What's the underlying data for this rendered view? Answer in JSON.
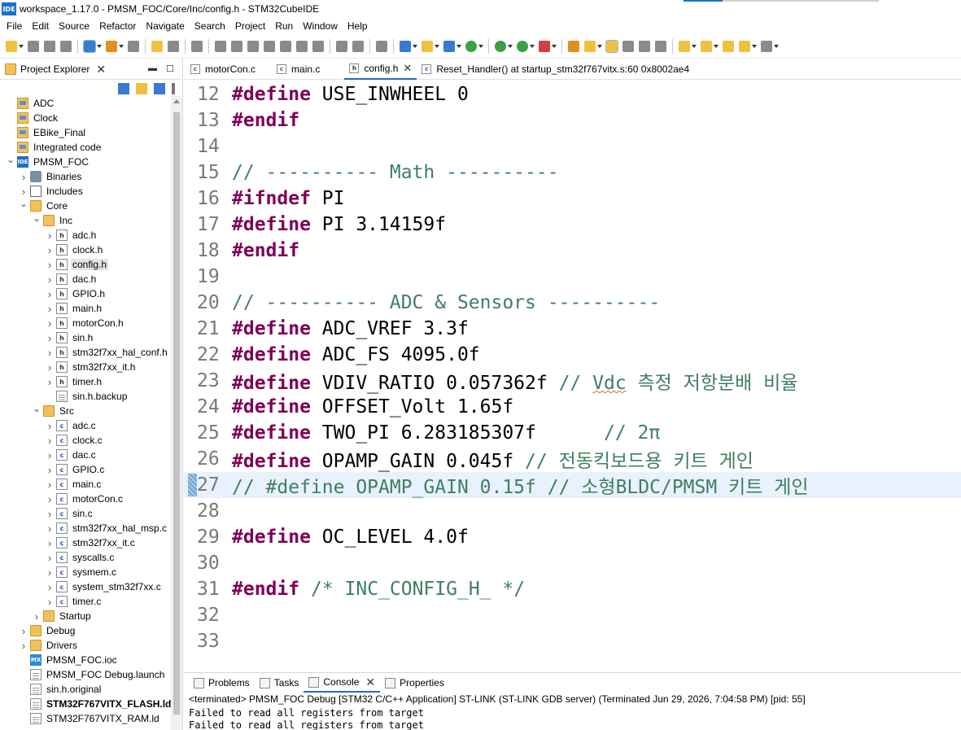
{
  "window": {
    "title": "workspace_1.17.0 - PMSM_FOC/Core/Inc/config.h - STM32CubeIDE",
    "app_icon": "IDE"
  },
  "menu": [
    "File",
    "Edit",
    "Source",
    "Refactor",
    "Navigate",
    "Search",
    "Project",
    "Run",
    "Window",
    "Help"
  ],
  "project_explorer": {
    "title": "Project Explorer",
    "tree": [
      {
        "label": "ADC",
        "icon": "project-folder-icon",
        "depth": 0,
        "arrow": ""
      },
      {
        "label": "Clock",
        "icon": "project-folder-icon",
        "depth": 0,
        "arrow": ""
      },
      {
        "label": "EBike_Final",
        "icon": "project-folder-icon",
        "depth": 0,
        "arrow": ""
      },
      {
        "label": "Integrated code",
        "icon": "project-folder-icon",
        "depth": 0,
        "arrow": ""
      },
      {
        "label": "PMSM_FOC",
        "icon": "ide-project-icon",
        "depth": 0,
        "arrow": "down"
      },
      {
        "label": "Binaries",
        "icon": "binaries-icon",
        "depth": 1,
        "arrow": "right"
      },
      {
        "label": "Includes",
        "icon": "includes-icon",
        "depth": 1,
        "arrow": "right"
      },
      {
        "label": "Core",
        "icon": "folder-icon",
        "depth": 1,
        "arrow": "down"
      },
      {
        "label": "Inc",
        "icon": "folder-icon",
        "depth": 2,
        "arrow": "down"
      },
      {
        "label": "adc.h",
        "icon": "header-file-icon",
        "depth": 3,
        "arrow": "right"
      },
      {
        "label": "clock.h",
        "icon": "header-file-icon",
        "depth": 3,
        "arrow": "right"
      },
      {
        "label": "config.h",
        "icon": "header-file-icon",
        "depth": 3,
        "arrow": "right",
        "selected": true
      },
      {
        "label": "dac.h",
        "icon": "header-file-icon",
        "depth": 3,
        "arrow": "right"
      },
      {
        "label": "GPIO.h",
        "icon": "header-file-icon",
        "depth": 3,
        "arrow": "right"
      },
      {
        "label": "main.h",
        "icon": "header-file-icon",
        "depth": 3,
        "arrow": "right"
      },
      {
        "label": "motorCon.h",
        "icon": "header-file-icon",
        "depth": 3,
        "arrow": "right"
      },
      {
        "label": "sin.h",
        "icon": "header-file-icon",
        "depth": 3,
        "arrow": "right"
      },
      {
        "label": "stm32f7xx_hal_conf.h",
        "icon": "header-file-icon",
        "depth": 3,
        "arrow": "right"
      },
      {
        "label": "stm32f7xx_it.h",
        "icon": "header-file-icon",
        "depth": 3,
        "arrow": "right"
      },
      {
        "label": "timer.h",
        "icon": "header-file-icon",
        "depth": 3,
        "arrow": "right"
      },
      {
        "label": "sin.h.backup",
        "icon": "text-file-icon",
        "depth": 3,
        "arrow": ""
      },
      {
        "label": "Src",
        "icon": "folder-icon",
        "depth": 2,
        "arrow": "down"
      },
      {
        "label": "adc.c",
        "icon": "c-file-icon",
        "depth": 3,
        "arrow": "right"
      },
      {
        "label": "clock.c",
        "icon": "c-file-icon",
        "depth": 3,
        "arrow": "right"
      },
      {
        "label": "dac.c",
        "icon": "c-file-icon",
        "depth": 3,
        "arrow": "right"
      },
      {
        "label": "GPIO.c",
        "icon": "c-file-icon",
        "depth": 3,
        "arrow": "right"
      },
      {
        "label": "main.c",
        "icon": "c-file-icon",
        "depth": 3,
        "arrow": "right"
      },
      {
        "label": "motorCon.c",
        "icon": "c-file-icon",
        "depth": 3,
        "arrow": "right"
      },
      {
        "label": "sin.c",
        "icon": "c-file-icon",
        "depth": 3,
        "arrow": "right"
      },
      {
        "label": "stm32f7xx_hal_msp.c",
        "icon": "c-file-icon",
        "depth": 3,
        "arrow": "right"
      },
      {
        "label": "stm32f7xx_it.c",
        "icon": "c-file-icon",
        "depth": 3,
        "arrow": "right"
      },
      {
        "label": "syscalls.c",
        "icon": "c-file-icon",
        "depth": 3,
        "arrow": "right"
      },
      {
        "label": "sysmem.c",
        "icon": "c-file-icon",
        "depth": 3,
        "arrow": "right"
      },
      {
        "label": "system_stm32f7xx.c",
        "icon": "c-file-icon",
        "depth": 3,
        "arrow": "right"
      },
      {
        "label": "timer.c",
        "icon": "c-file-icon",
        "depth": 3,
        "arrow": "right"
      },
      {
        "label": "Startup",
        "icon": "folder-icon",
        "depth": 2,
        "arrow": "right"
      },
      {
        "label": "Debug",
        "icon": "folder-icon",
        "depth": 1,
        "arrow": "right"
      },
      {
        "label": "Drivers",
        "icon": "folder-icon",
        "depth": 1,
        "arrow": "right"
      },
      {
        "label": "PMSM_FOC.ioc",
        "icon": "mx-file-icon",
        "depth": 1,
        "arrow": ""
      },
      {
        "label": "PMSM_FOC Debug.launch",
        "icon": "text-file-icon",
        "depth": 1,
        "arrow": ""
      },
      {
        "label": "sin.h.original",
        "icon": "text-file-icon",
        "depth": 1,
        "arrow": ""
      },
      {
        "label": "STM32F767VITX_FLASH.ld",
        "icon": "text-file-icon",
        "depth": 1,
        "arrow": "",
        "bold": true
      },
      {
        "label": "STM32F767VITX_RAM.ld",
        "icon": "text-file-icon",
        "depth": 1,
        "arrow": ""
      }
    ]
  },
  "editor_tabs": [
    {
      "label": "motorCon.c",
      "icon": "c-file-icon",
      "active": false
    },
    {
      "label": "main.c",
      "icon": "c-file-icon",
      "active": false
    },
    {
      "label": "config.h",
      "icon": "header-file-icon",
      "active": true,
      "closable": true
    },
    {
      "label": "Reset_Handler() at startup_stm32f767vitx.s:60 0x8002ae4",
      "icon": "c-file-icon",
      "active": false
    }
  ],
  "code_lines": [
    {
      "n": "12",
      "tokens": [
        {
          "t": "kw",
          "s": "#define"
        },
        {
          "t": "plain",
          "s": " USE_INWHEEL 0"
        }
      ]
    },
    {
      "n": "13",
      "tokens": [
        {
          "t": "kw",
          "s": "#endif"
        }
      ]
    },
    {
      "n": "14",
      "tokens": []
    },
    {
      "n": "15",
      "tokens": [
        {
          "t": "cm",
          "s": "// ---------- Math ----------"
        }
      ]
    },
    {
      "n": "16",
      "tokens": [
        {
          "t": "kw",
          "s": "#ifndef"
        },
        {
          "t": "plain",
          "s": " PI"
        }
      ]
    },
    {
      "n": "17",
      "tokens": [
        {
          "t": "kw",
          "s": "#define"
        },
        {
          "t": "plain",
          "s": " PI 3.14159f"
        }
      ]
    },
    {
      "n": "18",
      "tokens": [
        {
          "t": "kw",
          "s": "#endif"
        }
      ]
    },
    {
      "n": "19",
      "tokens": []
    },
    {
      "n": "20",
      "tokens": [
        {
          "t": "cm",
          "s": "// ---------- ADC & Sensors ----------"
        }
      ]
    },
    {
      "n": "21",
      "tokens": [
        {
          "t": "kw",
          "s": "#define"
        },
        {
          "t": "plain",
          "s": " ADC_VREF 3.3f"
        }
      ]
    },
    {
      "n": "22",
      "tokens": [
        {
          "t": "kw",
          "s": "#define"
        },
        {
          "t": "plain",
          "s": " ADC_FS 4095.0f"
        }
      ]
    },
    {
      "n": "23",
      "tokens": [
        {
          "t": "kw",
          "s": "#define"
        },
        {
          "t": "plain",
          "s": " VDIV_RATIO 0.057362f "
        },
        {
          "t": "cm",
          "s": "// "
        },
        {
          "t": "cm squig",
          "s": "Vdc"
        },
        {
          "t": "cm",
          "s": " 측정 저항분배 비율"
        }
      ]
    },
    {
      "n": "24",
      "tokens": [
        {
          "t": "kw",
          "s": "#define"
        },
        {
          "t": "plain",
          "s": " OFFSET_Volt 1.65f"
        }
      ]
    },
    {
      "n": "25",
      "tokens": [
        {
          "t": "kw",
          "s": "#define"
        },
        {
          "t": "plain",
          "s": " TWO_PI 6.283185307f      "
        },
        {
          "t": "cm",
          "s": "// 2π"
        }
      ]
    },
    {
      "n": "26",
      "tokens": [
        {
          "t": "kw",
          "s": "#define"
        },
        {
          "t": "plain",
          "s": " OPAMP_GAIN 0.045f "
        },
        {
          "t": "cm",
          "s": "// 전동킥보드용 키트 게인"
        }
      ]
    },
    {
      "n": "27",
      "tokens": [
        {
          "t": "cm",
          "s": "// #define OPAMP_GAIN 0.15f // 소형BLDC/PMSM 키트 게인"
        }
      ],
      "current": true
    },
    {
      "n": "28",
      "tokens": []
    },
    {
      "n": "29",
      "tokens": [
        {
          "t": "kw",
          "s": "#define"
        },
        {
          "t": "plain",
          "s": " OC_LEVEL 4.0f"
        }
      ]
    },
    {
      "n": "30",
      "tokens": []
    },
    {
      "n": "31",
      "tokens": [
        {
          "t": "kw",
          "s": "#endif"
        },
        {
          "t": "plain",
          "s": " "
        },
        {
          "t": "cm",
          "s": "/* INC_CONFIG_H_ */"
        }
      ]
    },
    {
      "n": "32",
      "tokens": []
    },
    {
      "n": "33",
      "tokens": []
    }
  ],
  "bottom_tabs": [
    {
      "label": "Problems",
      "icon": "problems-icon",
      "active": false
    },
    {
      "label": "Tasks",
      "icon": "tasks-icon",
      "active": false
    },
    {
      "label": "Console",
      "icon": "console-icon",
      "active": true,
      "closable": true
    },
    {
      "label": "Properties",
      "icon": "properties-icon",
      "active": false
    }
  ],
  "console": {
    "header": "<terminated> PMSM_FOC Debug [STM32 C/C++ Application] ST-LINK (ST-LINK GDB server) (Terminated Jun 29, 2026, 7:04:58 PM) [pid: 55]",
    "lines": [
      "Failed to read all registers from target",
      "Failed to read all registers from target"
    ]
  },
  "colors": {
    "keyword": "#7f0055",
    "comment": "#3f7f5f",
    "current_line": "#e8f2fe",
    "accent": "#1c70c8"
  }
}
